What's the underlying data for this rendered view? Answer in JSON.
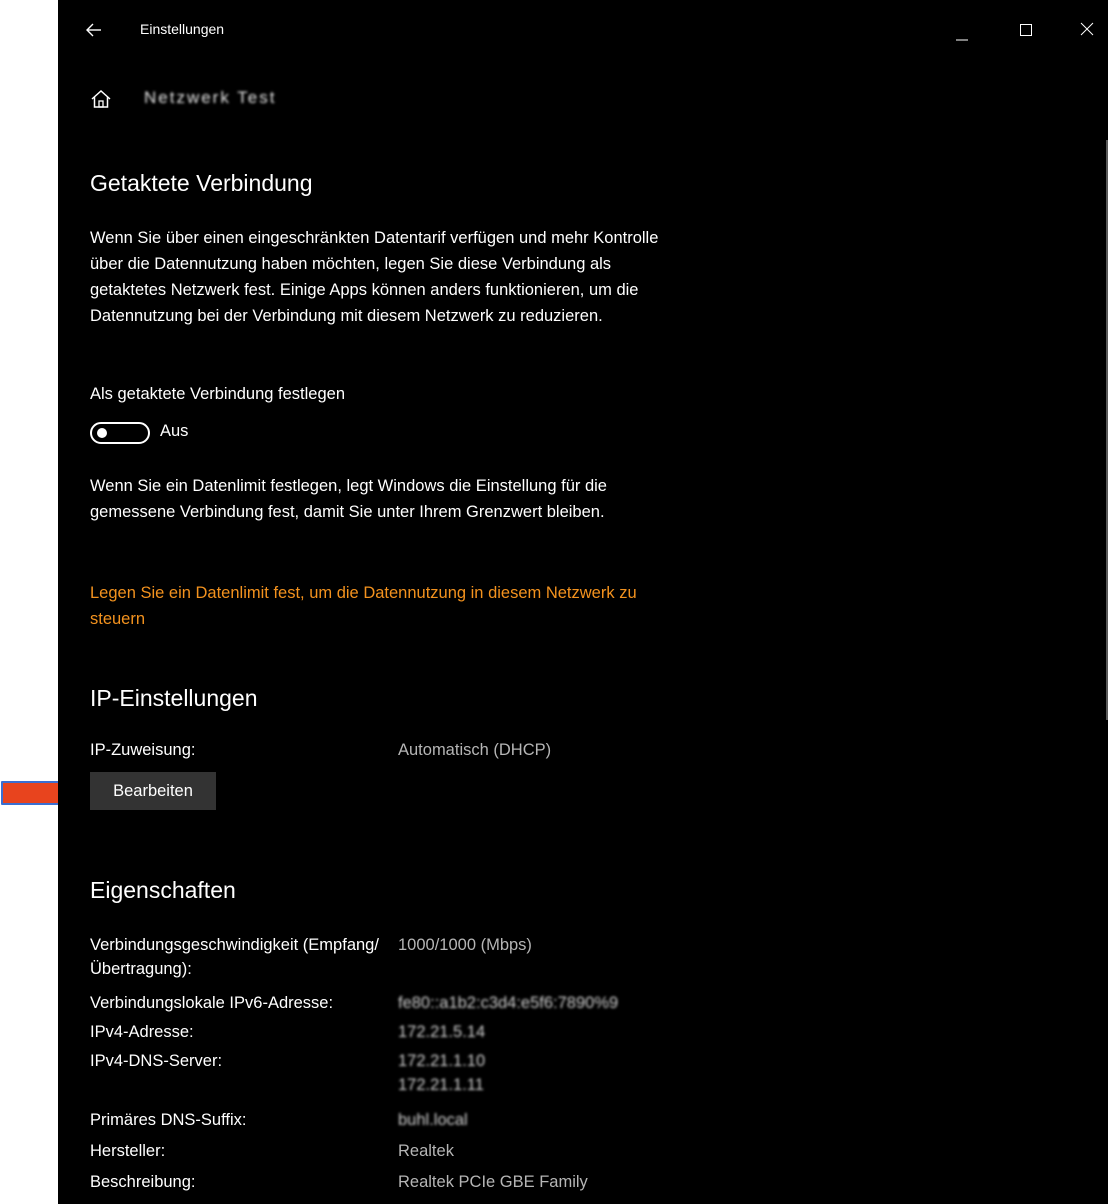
{
  "window": {
    "title": "Einstellungen",
    "network_name": "Netzwerk Test"
  },
  "metered": {
    "heading": "Getaktete Verbindung",
    "description": "Wenn Sie über einen eingeschränkten Datentarif verfügen und mehr Kontrolle über die Datennutzung haben möchten, legen Sie diese Verbindung als getaktetes Netzwerk fest. Einige Apps können anders funktionieren, um die Datennutzung bei der Verbindung mit diesem Netzwerk zu reduzieren.",
    "toggle_label": "Als getaktete Verbindung festlegen",
    "toggle_state": "Aus",
    "limit_note": "Wenn Sie ein Datenlimit festlegen, legt Windows die Einstellung für die gemessene Verbindung fest, damit Sie unter Ihrem Grenzwert bleiben.",
    "limit_link": "Legen Sie ein Datenlimit fest, um die Datennutzung in diesem Netzwerk zu steuern"
  },
  "ip_settings": {
    "heading": "IP-Einstellungen",
    "assignment_label": "IP-Zuweisung:",
    "assignment_value": "Automatisch (DHCP)",
    "edit_button": "Bearbeiten"
  },
  "properties": {
    "heading": "Eigenschaften",
    "rows": [
      {
        "key": "Verbindungsgeschwindigkeit (Empfang/Übertragung):",
        "value": "1000/1000 (Mbps)"
      },
      {
        "key": "Verbindungslokale IPv6-Adresse:",
        "value": "fe80::a1b2:c3d4:e5f6:7890%9"
      },
      {
        "key": "IPv4-Adresse:",
        "value": "172.21.5.14"
      },
      {
        "key": "IPv4-DNS-Server:",
        "value": "172.21.1.10",
        "value2": "172.21.1.11"
      },
      {
        "key": "Primäres DNS-Suffix:",
        "value": "buhl.local"
      },
      {
        "key": "Hersteller:",
        "value": "Realtek"
      },
      {
        "key": "Beschreibung:",
        "value": "Realtek PCIe GBE Family"
      }
    ]
  },
  "colors": {
    "accent_link": "#f3921e",
    "annotation_arrow": "#e8441e",
    "annotation_arrow_outline": "#3b6fd1"
  }
}
